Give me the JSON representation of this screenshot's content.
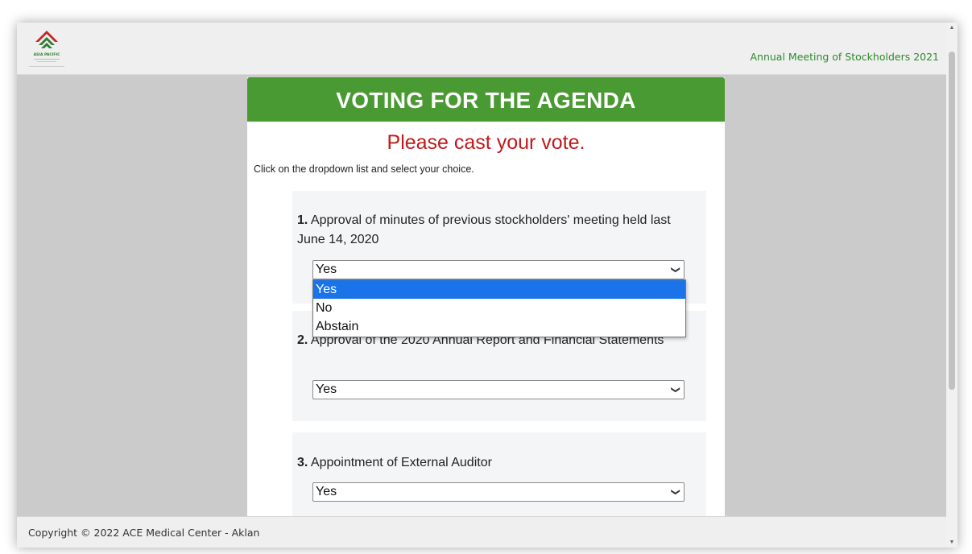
{
  "header": {
    "logo_text": "ASIA PACIFIC",
    "meeting_title": "Annual Meeting of Stockholders 2021"
  },
  "panel": {
    "title": "VOTING FOR THE AGENDA",
    "subtitle": "Please cast your vote.",
    "instruction": "Click on the dropdown list and select your choice."
  },
  "questions": [
    {
      "number": "1.",
      "text": "Approval of minutes of previous stockholders' meeting held last June 14, 2020",
      "selected": "Yes"
    },
    {
      "number": "2.",
      "text": "Approval of the 2020 Annual Report and Financial Statements",
      "selected": "Yes"
    },
    {
      "number": "3.",
      "text": "Appointment of External Auditor",
      "selected": "Yes"
    }
  ],
  "dropdown": {
    "options": [
      "Yes",
      "No",
      "Abstain"
    ],
    "highlighted": "Yes"
  },
  "footer": {
    "copyright": "Copyright © 2022 ACE Medical Center - Aklan"
  },
  "colors": {
    "header_green": "#4a9a33",
    "subtitle_red": "#c0191b",
    "meeting_title_green": "#2f8a2f",
    "option_highlight": "#1a73e8"
  },
  "icons": {
    "select_arrow": "chevron-down-icon",
    "scroll_up": "scroll-up-arrow-icon",
    "scroll_down": "scroll-down-arrow-icon"
  }
}
